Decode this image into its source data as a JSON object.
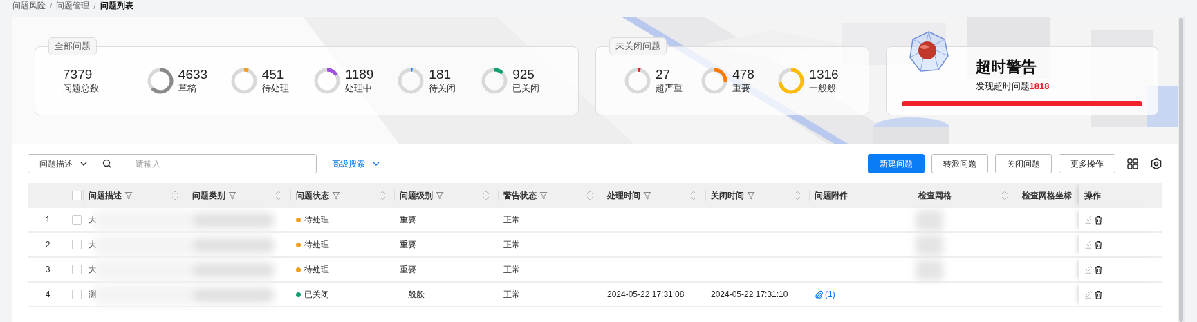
{
  "breadcrumb": [
    {
      "label": "问题风险",
      "kind": "link"
    },
    {
      "label": "/",
      "kind": "separator"
    },
    {
      "label": "问题管理",
      "kind": "link"
    },
    {
      "label": "/",
      "kind": "separator"
    },
    {
      "label": "问题列表",
      "kind": "current"
    }
  ],
  "all_issues": {
    "title": "全部问题",
    "total": {
      "value": "7379",
      "label": "问题总数"
    },
    "stats": [
      {
        "value": "4633",
        "label": "草稿",
        "level": 0.628,
        "color": "#8a8a8a"
      },
      {
        "value": "451",
        "label": "待处理",
        "level": 0.061,
        "color": "#f0a020"
      },
      {
        "value": "1189",
        "label": "处理中",
        "level": 0.161,
        "color": "#a050e0"
      },
      {
        "value": "181",
        "label": "待关闭",
        "level": 0.025,
        "color": "#1e7ff0"
      },
      {
        "value": "925",
        "label": "已关闭",
        "level": 0.125,
        "color": "#10a070"
      }
    ]
  },
  "open_issues": {
    "title": "未关闭问题",
    "stats": [
      {
        "value": "27",
        "label": "超严重",
        "level": 0.04,
        "color": "#e02020"
      },
      {
        "value": "478",
        "label": "重要",
        "level": 0.262,
        "color": "#ff7a00"
      },
      {
        "value": "1316",
        "label": "一般般",
        "level": 0.723,
        "color": "#ffbb00"
      }
    ]
  },
  "timeout_warning": {
    "title": "超时警告",
    "text": "发现超时问题",
    "count": "1818",
    "level": 1
  },
  "search": {
    "field": "问题描述",
    "placeholder": "请输入",
    "advanced": "高级搜索"
  },
  "buttons": [
    {
      "label": "新建问题",
      "primary": true
    },
    {
      "label": "转派问题",
      "primary": false
    },
    {
      "label": "关闭问题",
      "primary": false
    },
    {
      "label": "更多操作",
      "primary": false
    }
  ],
  "table": {
    "select_all_checked": false,
    "columns": [
      {
        "label": "问题描述",
        "filter": true,
        "sort": true
      },
      {
        "label": "问题类别",
        "filter": true,
        "sort": true
      },
      {
        "label": "问题状态",
        "filter": true,
        "sort": true
      },
      {
        "label": "问题级别",
        "filter": true,
        "sort": true
      },
      {
        "label": "警告状态",
        "filter": true,
        "sort": true
      },
      {
        "label": "处理时间",
        "filter": true,
        "sort": true
      },
      {
        "label": "关闭时间",
        "filter": true,
        "sort": true
      },
      {
        "label": "问题附件",
        "filter": false,
        "sort": false
      },
      {
        "label": "检查网格",
        "filter": false,
        "sort": true
      },
      {
        "label": "检查网格坐标",
        "filter": false,
        "sort": false
      },
      {
        "label": "操作",
        "filter": false,
        "sort": false
      }
    ],
    "rows": [
      {
        "index": "1",
        "checked": false,
        "description": "大",
        "status": {
          "label": "待处理",
          "color": "#f0a020"
        },
        "level": "重要",
        "warning": "正常",
        "grid_blurred": true
      },
      {
        "index": "2",
        "checked": false,
        "description": "大",
        "status": {
          "label": "待处理",
          "color": "#f0a020"
        },
        "level": "重要",
        "warning": "正常",
        "grid_blurred": true
      },
      {
        "index": "3",
        "checked": false,
        "description": "大",
        "status": {
          "label": "待处理",
          "color": "#f0a020"
        },
        "level": "重要",
        "warning": "正常",
        "grid_blurred": true
      },
      {
        "index": "4",
        "checked": false,
        "description": "测",
        "status": {
          "label": "已关闭",
          "color": "#10a070"
        },
        "level": "一般般",
        "warning": "正常",
        "handled_at": "2024-05-22 17:31:08",
        "closed_at": "2024-05-22 17:31:10",
        "attachment": "(1)",
        "grid_blurred": false
      }
    ]
  }
}
